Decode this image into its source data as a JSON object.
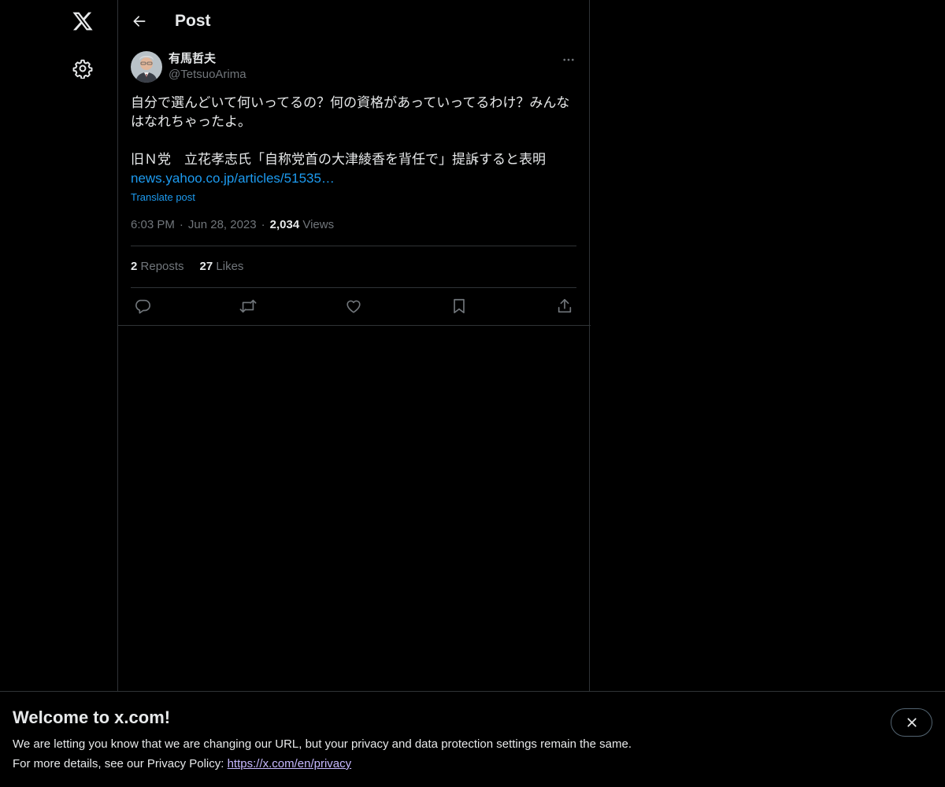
{
  "header": {
    "title": "Post"
  },
  "post": {
    "author_name": "有馬哲夫",
    "author_handle": "@TetsuoArima",
    "text_line_1": "自分で選んどいて何いってるの？何の資格があっていってるわけ？みんな",
    "text_line_2": "はなれちゃったよ。",
    "text_line_3": "旧Ｎ党　立花孝志氏「自称党首の大津綾香を背任で」提訴すると表明",
    "link_text": "news.yahoo.co.jp/articles/51535…",
    "translate_label": "Translate post",
    "time": "6:03 PM",
    "date": "Jun 28, 2023",
    "views_count": "2,034",
    "views_label": "Views",
    "reposts_count": "2",
    "reposts_label": "Reposts",
    "likes_count": "27",
    "likes_label": "Likes"
  },
  "banner": {
    "title": "Welcome to x.com!",
    "line_1": "We are letting you know that we are changing our URL, but your privacy and data protection settings remain the same.",
    "line_2_prefix": "For more details, see our Privacy Policy: ",
    "line_2_link": "https://x.com/en/privacy"
  },
  "icons": {
    "logo": "x-logo-icon",
    "settings": "gear-icon",
    "back": "arrow-left-icon",
    "more": "more-horizontal-icon",
    "reply": "reply-icon",
    "repost": "repost-icon",
    "like": "heart-icon",
    "bookmark": "bookmark-icon",
    "share": "share-icon",
    "close": "close-icon"
  },
  "colors": {
    "background": "#000000",
    "text": "#e7e9ea",
    "muted": "#71767b",
    "link": "#1d9bf0",
    "border": "#2f3336"
  }
}
